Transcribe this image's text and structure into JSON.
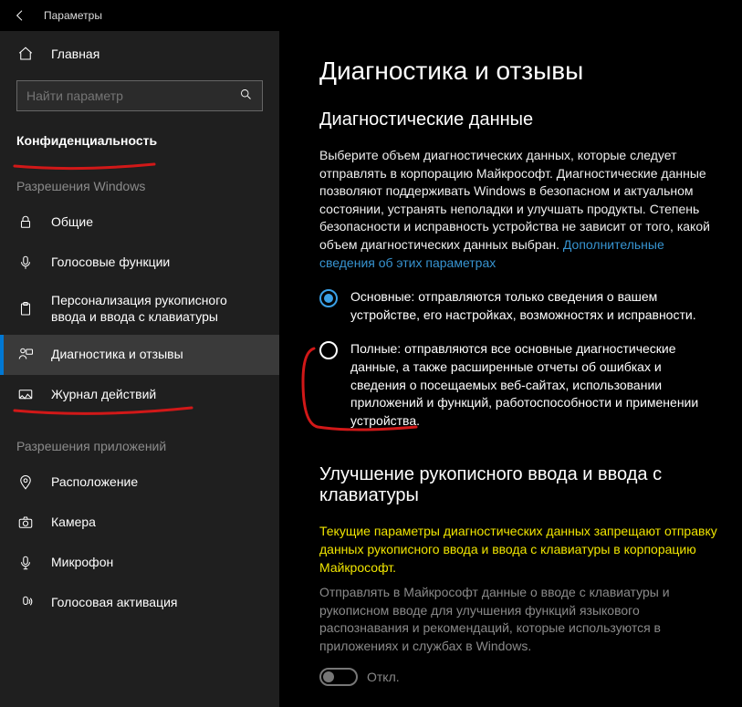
{
  "window": {
    "title": "Параметры"
  },
  "sidebar": {
    "home": "Главная",
    "search_placeholder": "Найти параметр",
    "category": "Конфиденциальность",
    "group1_title": "Разрешения Windows",
    "group1": [
      {
        "label": "Общие"
      },
      {
        "label": "Голосовые функции"
      },
      {
        "label": "Персонализация рукописного ввода и ввода с клавиатуры"
      },
      {
        "label": "Диагностика и отзывы"
      },
      {
        "label": "Журнал действий"
      }
    ],
    "group2_title": "Разрешения приложений",
    "group2": [
      {
        "label": "Расположение"
      },
      {
        "label": "Камера"
      },
      {
        "label": "Микрофон"
      },
      {
        "label": "Голосовая активация"
      }
    ]
  },
  "main": {
    "h1": "Диагностика и отзывы",
    "h2a": "Диагностические данные",
    "intro": "Выберите объем диагностических данных, которые следует отправлять в корпорацию Майкрософт. Диагностические данные позволяют поддерживать Windows в безопасном и актуальном состоянии, устранять неполадки и улучшать продукты. Степень безопасности и исправность устройства не зависит от того, какой объем диагностических данных выбран. ",
    "intro_link": "Дополнительные сведения об этих параметрах",
    "opt1": "Основные: отправляются только сведения о вашем устройстве, его настройках, возможностях и исправности.",
    "opt2": "Полные: отправляются все основные диагностические данные, а также расширенные отчеты об ошибках и сведения о посещаемых веб-сайтах, использовании приложений и функций, работоспособности и применении устройства.",
    "h2b": "Улучшение рукописного ввода и ввода с клавиатуры",
    "warn": "Текущие параметры диагностических данных запрещают отправку данных рукописного ввода и ввода с клавиатуры в корпорацию Майкрософт.",
    "desc2": "Отправлять в Майкрософт данные о вводе с клавиатуры и рукописном вводе для улучшения функций языкового распознавания и рекомендаций, которые используются в приложениях и службах в Windows.",
    "toggle_label": "Откл."
  }
}
